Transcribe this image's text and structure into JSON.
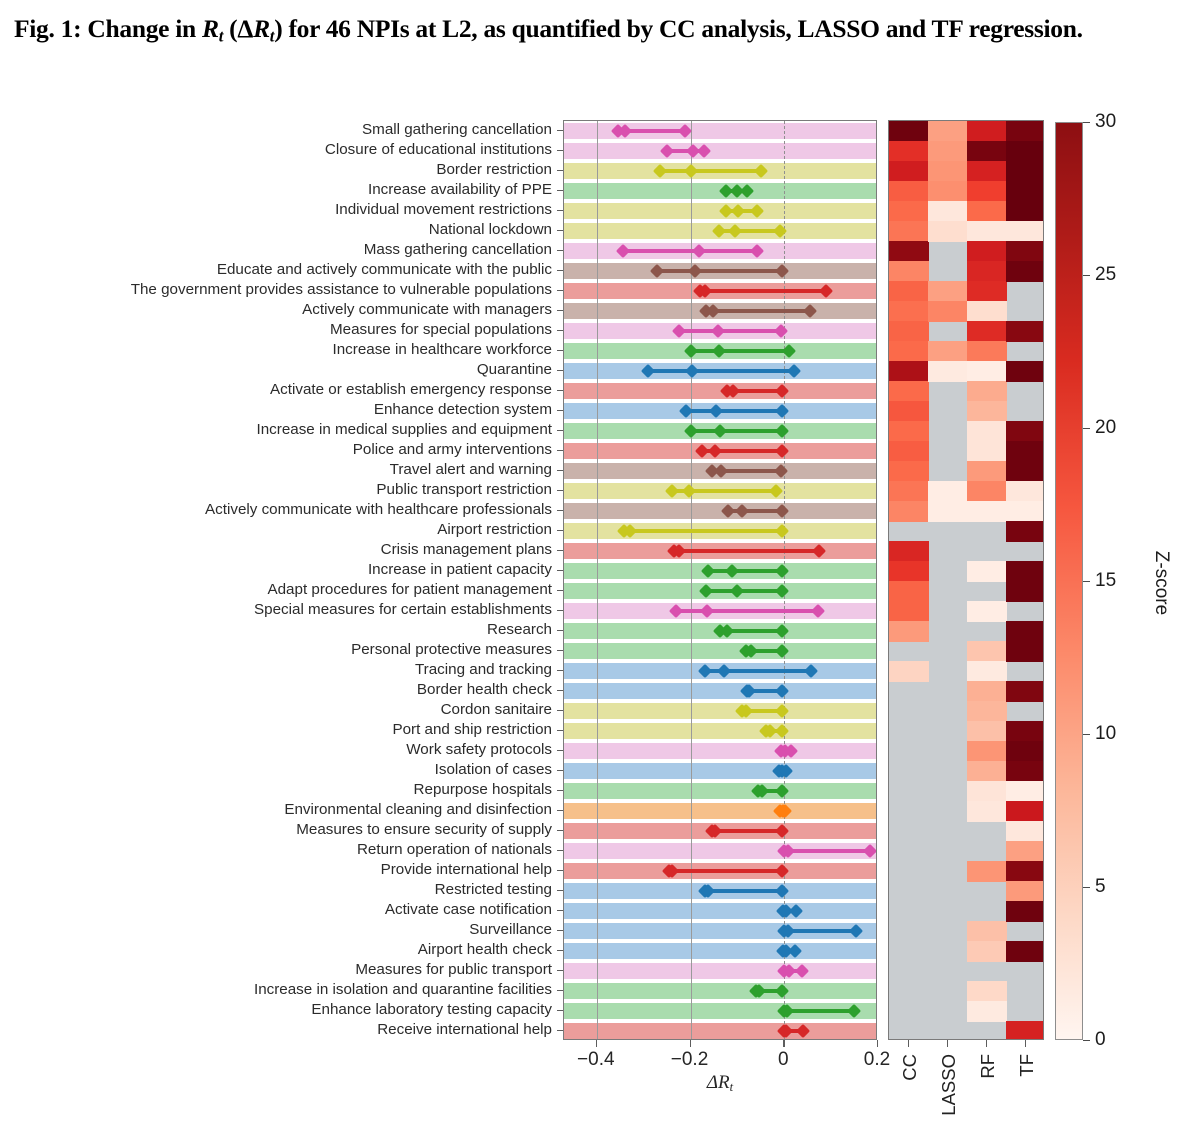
{
  "caption": {
    "prefix": "Fig. 1: Change in ",
    "r1": "R",
    "sub1": "t",
    "mid": " (Δ",
    "r2": "R",
    "sub2": "t",
    "suffix": ") for 46 NPIs at L2, as quantified by CC analysis, LASSO and TF regression."
  },
  "axes": {
    "xlabel_delta": "ΔR",
    "xlabel_sub": "t",
    "xticks": [
      -0.4,
      -0.2,
      0,
      0.2
    ],
    "xtick_labels": [
      "−0.4",
      "−0.2",
      "0",
      "0.2"
    ],
    "xlim": [
      -0.47,
      0.2
    ],
    "gridlines": [
      -0.4,
      -0.2,
      0.0
    ]
  },
  "heatmap": {
    "columns": [
      "CC",
      "LASSO",
      "RF",
      "TF"
    ],
    "missing_color": "#c9cdd0",
    "colorbar": {
      "title": "Z-score",
      "ticks": [
        0,
        5,
        10,
        15,
        20,
        25,
        30
      ],
      "tick_labels": [
        "0",
        "5",
        "10",
        "15",
        "20",
        "25",
        "30"
      ],
      "vmin": 0,
      "vmax": 30
    }
  },
  "chart_data": {
    "type": "bar",
    "title": "Change in Rt (ΔRt) for 46 NPIs at L2, as quantified by CC analysis, LASSO and TF regression.",
    "xlabel": "ΔRt",
    "ylabel": "",
    "xlim": [
      -0.47,
      0.2
    ],
    "grid": true,
    "legend": "none",
    "categories": [
      "Small gathering cancellation",
      "Closure of educational institutions",
      "Border restriction",
      "Increase availability of PPE",
      "Individual movement restrictions",
      "National lockdown",
      "Mass gathering cancellation",
      "Educate and actively communicate with the public",
      "The government provides assistance to vulnerable populations",
      "Actively communicate with managers",
      "Measures for special populations",
      "Increase in healthcare workforce",
      "Quarantine",
      "Activate or establish emergency response",
      "Enhance detection system",
      "Increase in medical supplies and equipment",
      "Police and army interventions",
      "Travel alert and warning",
      "Public transport restriction",
      "Actively communicate with healthcare professionals",
      "Airport restriction",
      "Crisis management plans",
      "Increase in patient capacity",
      "Adapt procedures for patient management",
      "Special measures for certain establishments",
      "Research",
      "Personal protective measures",
      "Tracing and tracking",
      "Border health check",
      "Cordon sanitaire",
      "Port and ship restriction",
      "Work safety protocols",
      "Isolation of cases",
      "Repurpose hospitals",
      "Environmental cleaning and disinfection",
      "Measures to ensure security of supply",
      "Return operation of nationals",
      "Provide international help",
      "Restricted testing",
      "Activate case notification",
      "Surveillance",
      "Airport health check",
      "Measures for public transport",
      "Increase in isolation and quarantine facilities",
      "Enhance laboratory testing capacity",
      "Receive international help"
    ],
    "band_colors": [
      "#efc8e6",
      "#efc8e6",
      "#e3e2a0",
      "#a9dcae",
      "#e3e2a0",
      "#e3e2a0",
      "#efc8e6",
      "#c9b2ab",
      "#eb9d9b",
      "#c9b2ab",
      "#efc8e6",
      "#a9dcae",
      "#a8c9e6",
      "#eb9d9b",
      "#a8c9e6",
      "#a9dcae",
      "#eb9d9b",
      "#c9b2ab",
      "#e3e2a0",
      "#c9b2ab",
      "#e3e2a0",
      "#eb9d9b",
      "#a9dcae",
      "#a9dcae",
      "#efc8e6",
      "#a9dcae",
      "#a9dcae",
      "#a8c9e6",
      "#a8c9e6",
      "#e3e2a0",
      "#e3e2a0",
      "#efc8e6",
      "#a8c9e6",
      "#a9dcae",
      "#f6c08a",
      "#eb9d9b",
      "#efc8e6",
      "#eb9d9b",
      "#a8c9e6",
      "#a8c9e6",
      "#a8c9e6",
      "#a8c9e6",
      "#efc8e6",
      "#a9dcae",
      "#a9dcae",
      "#eb9d9b"
    ],
    "marker_colors": [
      "#d94fae",
      "#d94fae",
      "#c8c81e",
      "#2da02d",
      "#c8c81e",
      "#c8c81e",
      "#d94fae",
      "#8c564b",
      "#d62728",
      "#8c564b",
      "#d94fae",
      "#2da02d",
      "#1f77b4",
      "#d62728",
      "#1f77b4",
      "#2da02d",
      "#d62728",
      "#8c564b",
      "#c8c81e",
      "#8c564b",
      "#c8c81e",
      "#d62728",
      "#2da02d",
      "#2da02d",
      "#d94fae",
      "#2da02d",
      "#2da02d",
      "#1f77b4",
      "#1f77b4",
      "#c8c81e",
      "#c8c81e",
      "#d94fae",
      "#1f77b4",
      "#2da02d",
      "#ff7f0e",
      "#d62728",
      "#d94fae",
      "#d62728",
      "#1f77b4",
      "#1f77b4",
      "#1f77b4",
      "#1f77b4",
      "#d94fae",
      "#2da02d",
      "#2da02d",
      "#d62728"
    ],
    "series": [
      {
        "name": "CI lower",
        "values": [
          -0.355,
          -0.25,
          -0.265,
          -0.125,
          -0.125,
          -0.14,
          -0.345,
          -0.272,
          -0.18,
          -0.168,
          -0.225,
          -0.2,
          -0.29,
          -0.122,
          -0.21,
          -0.2,
          -0.176,
          -0.155,
          -0.24,
          -0.12,
          -0.342,
          -0.235,
          -0.162,
          -0.168,
          -0.23,
          -0.138,
          -0.082,
          -0.17,
          -0.08,
          -0.09,
          -0.04,
          -0.008,
          -0.012,
          -0.055,
          -0.01,
          -0.155,
          0.0,
          -0.245,
          -0.17,
          -0.002,
          0.0,
          -0.002,
          0.0,
          -0.06,
          0.0,
          0.0
        ]
      },
      {
        "name": "Median",
        "values": [
          -0.34,
          -0.195,
          -0.2,
          -0.1,
          -0.098,
          -0.105,
          -0.182,
          -0.19,
          -0.17,
          -0.153,
          -0.142,
          -0.14,
          -0.197,
          -0.11,
          -0.145,
          -0.138,
          -0.148,
          -0.135,
          -0.203,
          -0.09,
          -0.33,
          -0.225,
          -0.112,
          -0.1,
          -0.165,
          -0.122,
          -0.07,
          -0.128,
          -0.075,
          -0.082,
          -0.03,
          0.002,
          -0.005,
          -0.048,
          -0.002,
          -0.148,
          0.008,
          -0.24,
          -0.162,
          0.004,
          0.008,
          0.004,
          0.01,
          -0.054,
          0.006,
          0.004
        ]
      },
      {
        "name": "CI upper",
        "values": [
          -0.212,
          -0.172,
          -0.05,
          -0.08,
          -0.058,
          -0.01,
          -0.058,
          -0.005,
          0.09,
          0.055,
          -0.008,
          0.01,
          0.02,
          -0.005,
          -0.005,
          -0.005,
          -0.005,
          -0.008,
          -0.018,
          -0.005,
          -0.005,
          0.075,
          -0.005,
          -0.005,
          0.072,
          -0.005,
          -0.005,
          0.058,
          -0.005,
          -0.005,
          -0.005,
          0.014,
          0.003,
          -0.005,
          0.002,
          -0.005,
          0.182,
          -0.005,
          -0.005,
          0.024,
          0.152,
          0.022,
          0.038,
          -0.005,
          0.148,
          0.04
        ]
      }
    ],
    "heatmap_values": {
      "CC": [
        29.5,
        20.0,
        22.0,
        16.0,
        15.0,
        14.0,
        27.5,
        12.5,
        15.5,
        14.5,
        15.5,
        15.0,
        25.5,
        15.0,
        16.5,
        15.0,
        16.0,
        15.0,
        14.0,
        12.5,
        null,
        21.0,
        19.5,
        15.5,
        15.5,
        10.5,
        null,
        5.0,
        null,
        null,
        null,
        null,
        null,
        null,
        null,
        null,
        null,
        null,
        null,
        null,
        null,
        null,
        null,
        null,
        null,
        null
      ],
      "LASSO": [
        10.0,
        10.5,
        11.0,
        11.5,
        2.5,
        4.0,
        null,
        null,
        10.0,
        12.5,
        null,
        10.0,
        2.0,
        null,
        null,
        null,
        null,
        null,
        1.5,
        1.5,
        null,
        null,
        null,
        null,
        null,
        null,
        null,
        null,
        null,
        null,
        null,
        null,
        null,
        null,
        null,
        null,
        null,
        null,
        null,
        null,
        null,
        null,
        null,
        null,
        null,
        null
      ],
      "RF": [
        22.0,
        29.0,
        21.5,
        18.5,
        15.0,
        2.5,
        22.0,
        21.0,
        20.5,
        4.0,
        20.5,
        13.5,
        1.5,
        9.0,
        8.0,
        3.0,
        3.0,
        10.5,
        12.5,
        1.5,
        null,
        null,
        1.5,
        null,
        1.5,
        null,
        6.5,
        2.0,
        8.5,
        8.0,
        7.0,
        11.0,
        8.5,
        3.0,
        2.5,
        null,
        null,
        11.0,
        null,
        null,
        7.0,
        6.0,
        null,
        4.5,
        2.0,
        null
      ],
      "TF": [
        29.0,
        30.0,
        30.0,
        30.0,
        30.0,
        2.5,
        28.5,
        29.5,
        null,
        null,
        28.0,
        null,
        29.5,
        null,
        null,
        28.5,
        29.5,
        29.5,
        2.5,
        1.5,
        29.0,
        null,
        29.5,
        29.5,
        null,
        29.5,
        29.5,
        null,
        28.5,
        null,
        29.0,
        29.5,
        29.0,
        1.5,
        22.5,
        2.5,
        10.0,
        28.0,
        10.5,
        29.5,
        null,
        29.5,
        null,
        null,
        null,
        21.5
      ]
    }
  }
}
